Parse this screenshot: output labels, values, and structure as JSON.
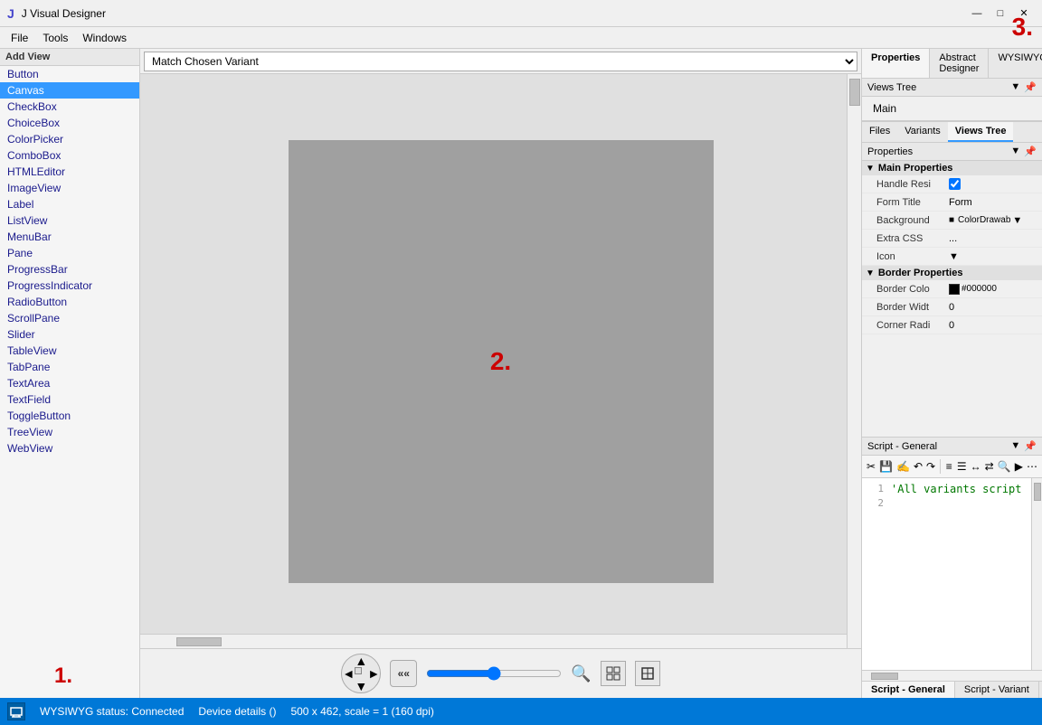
{
  "window": {
    "title": "J  Visual Designer",
    "controls": [
      "minimize",
      "maximize",
      "close"
    ]
  },
  "menu": {
    "items": [
      "File",
      "Tools",
      "Windows"
    ]
  },
  "left_panel": {
    "header": "Add View",
    "items": [
      "Button",
      "Canvas",
      "CheckBox",
      "ChoiceBox",
      "ColorPicker",
      "ComboBox",
      "HTMLEditor",
      "ImageView",
      "Label",
      "ListView",
      "MenuBar",
      "Pane",
      "ProgressBar",
      "ProgressIndicator",
      "RadioButton",
      "ScrollPane",
      "Slider",
      "TableView",
      "TabPane",
      "TextArea",
      "TextField",
      "ToggleButton",
      "TreeView",
      "WebView"
    ],
    "selected": "Canvas",
    "annotation": "1."
  },
  "toolbar": {
    "variant_options": [
      "Match Chosen Variant"
    ],
    "variant_selected": "Match Chosen Variant"
  },
  "canvas": {
    "annotation": "2.",
    "width": "500 x 462",
    "scale": "scale = 1 (160 dpi)"
  },
  "right_tabs": {
    "tabs": [
      "Properties",
      "Abstract Designer",
      "WYSIWYG"
    ],
    "active": "Properties"
  },
  "views_tree": {
    "label": "Views Tree",
    "items": [
      "Main"
    ],
    "pin_icon": "📌",
    "dropdown_icon": "▼"
  },
  "bottom_tabs": {
    "tabs": [
      "Files",
      "Variants",
      "Views Tree"
    ],
    "active": "Views Tree"
  },
  "properties": {
    "label": "Properties",
    "sections": [
      {
        "name": "Main Properties",
        "expanded": true,
        "props": [
          {
            "name": "Handle Resi",
            "value": "✓",
            "type": "checkbox"
          },
          {
            "name": "Form Title",
            "value": "Form",
            "type": "text"
          },
          {
            "name": "Background",
            "value": "ColorDrawab",
            "type": "dropdown"
          },
          {
            "name": "Extra CSS",
            "value": "...",
            "type": "text"
          },
          {
            "name": "Icon",
            "value": "",
            "type": "dropdown"
          }
        ]
      },
      {
        "name": "Border Properties",
        "expanded": true,
        "props": [
          {
            "name": "Border Colo",
            "value": "#000000",
            "type": "color"
          },
          {
            "name": "Border Widt",
            "value": "0",
            "type": "text"
          },
          {
            "name": "Corner Radi",
            "value": "0",
            "type": "text"
          }
        ]
      }
    ]
  },
  "script": {
    "header": "Script - General",
    "lines": [
      {
        "num": "1",
        "code": "'All variants script"
      },
      {
        "num": "2",
        "code": ""
      }
    ],
    "bottom_tabs": [
      "Script - General",
      "Script - Variant"
    ],
    "active_tab": "Script - General"
  },
  "status_bar": {
    "icon_label": "WYSIWYG",
    "status": "WYSIWYG status: Connected",
    "device": "Device details ()",
    "resolution": "500 x 462, scale = 1 (160 dpi)"
  },
  "annotation_3": "3."
}
